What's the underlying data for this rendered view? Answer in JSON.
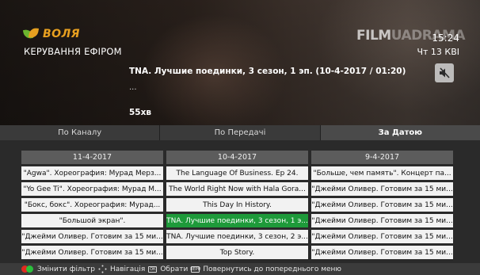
{
  "header": {
    "brand": "ВОЛЯ",
    "subtitle": "КЕРУВАННЯ ЕФІРОМ",
    "channel_logo_a": "FILM",
    "channel_logo_b": "UADRAMA",
    "time": "15:24",
    "date": "Чт 13 КВІ"
  },
  "now_playing": {
    "title": "TNA. Лучшие поединки, 3 сезон, 1 эп.   (10-4-2017 / 01:20)",
    "description": "...",
    "duration": "55хв",
    "mute_icon": "mute-icon"
  },
  "tabs": [
    {
      "label": "По Каналу",
      "active": false
    },
    {
      "label": "По Передачі",
      "active": false
    },
    {
      "label": "За Датою",
      "active": true
    }
  ],
  "columns": [
    {
      "date": "11-4-2017",
      "items": [
        "\"Agwa\". Хореография: Мурад Мерз...",
        "\"Yo Gee Ti\". Хореография: Мурад М...",
        "\"Бокс, бокс\". Хореография: Мурад...",
        "\"Большой экран\".",
        "\"Джейми Оливер. Готовим за 15 ми...",
        "\"Джейми Оливер. Готовим за 15 ми..."
      ]
    },
    {
      "date": "10-4-2017",
      "items": [
        "The Language Of Business. Ep 24.",
        "The World Right Now with Hala Gora...",
        "This Day In History.",
        "TNA. Лучшие поединки, 3 сезон, 1 э...",
        "TNA. Лучшие поединки, 3 сезон, 2 э...",
        "Top Story."
      ],
      "selected_index": 3
    },
    {
      "date": "9-4-2017",
      "items": [
        "\"Больше, чем память\". Концерт па...",
        "\"Джейми Оливер. Готовим за 15 ми...",
        "\"Джейми Оливер. Готовим за 15 ми...",
        "\"Джейми Оливер. Готовим за 15 ми...",
        "\"Джейми Оливер. Готовим за 15 ми...",
        "\"Джейми Оливер. Готовим за 15 ми..."
      ]
    }
  ],
  "footer": {
    "change_filter": "Змінити фільтр",
    "navigation": "Навігація",
    "ok_key": "ОК",
    "select": "Обрати",
    "back_key": "ВЕРН",
    "back": "Повернутись до попереднього меню"
  },
  "colors": {
    "accent": "#e8a020",
    "selected": "#1e9a3a",
    "red_key": "#e02a1f",
    "green_key": "#2bc03c"
  }
}
